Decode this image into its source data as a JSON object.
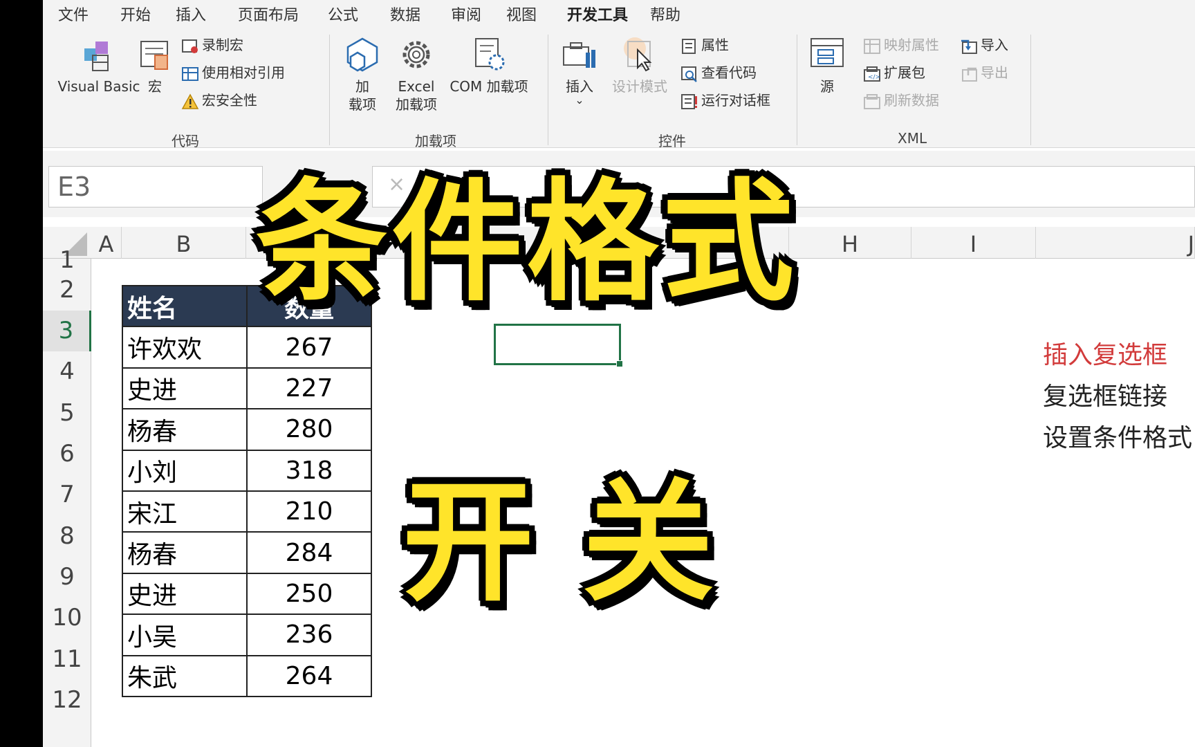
{
  "ribbon": {
    "tabs": [
      "文件",
      "开始",
      "插入",
      "页面布局",
      "公式",
      "数据",
      "审阅",
      "视图",
      "开发工具",
      "帮助"
    ],
    "active_tab": "开发工具",
    "code_group": {
      "label": "代码",
      "visual_basic": "Visual Basic",
      "macros": "宏",
      "record_macro": "录制宏",
      "relative_ref": "使用相对引用",
      "macro_security": "宏安全性"
    },
    "addins_group": {
      "label": "加载项",
      "addins_line1": "加",
      "addins_line2": "载项",
      "excel_addins_line1": "Excel",
      "excel_addins_line2": "加载项",
      "com_addins": "COM 加载项"
    },
    "controls_group": {
      "label": "控件",
      "insert": "插入",
      "design_mode": "设计模式",
      "properties": "属性",
      "view_code": "查看代码",
      "run_dialog": "运行对话框"
    },
    "xml_group": {
      "label": "XML",
      "source": "源",
      "map_properties": "映射属性",
      "expansion_packs": "扩展包",
      "refresh_data": "刷新数据",
      "import": "导入",
      "export": "导出"
    }
  },
  "formula_bar": {
    "name_box": "E3",
    "cancel": "×"
  },
  "grid": {
    "columns": [
      "A",
      "B",
      "H",
      "I",
      "J"
    ],
    "rows": [
      "1",
      "2",
      "3",
      "4",
      "5",
      "6",
      "7",
      "8",
      "9",
      "10",
      "11",
      "12"
    ],
    "selected_row": "3"
  },
  "table": {
    "headers": [
      "姓名",
      "数量"
    ],
    "rows": [
      [
        "许欢欢",
        "267"
      ],
      [
        "史进",
        "227"
      ],
      [
        "杨春",
        "280"
      ],
      [
        "小刘",
        "318"
      ],
      [
        "宋江",
        "210"
      ],
      [
        "杨春",
        "284"
      ],
      [
        "史进",
        "250"
      ],
      [
        "小吴",
        "236"
      ],
      [
        "朱武",
        "264"
      ]
    ]
  },
  "notes": [
    "插入复选框",
    "复选框链接",
    "设置条件格式"
  ],
  "overlay": {
    "title": "条件格式",
    "subtitle": "开关"
  },
  "colors": {
    "accent": "#217346",
    "header_fill": "#2b3a52",
    "note_red": "#d23b3b",
    "overlay_yellow": "#ffe42a"
  }
}
